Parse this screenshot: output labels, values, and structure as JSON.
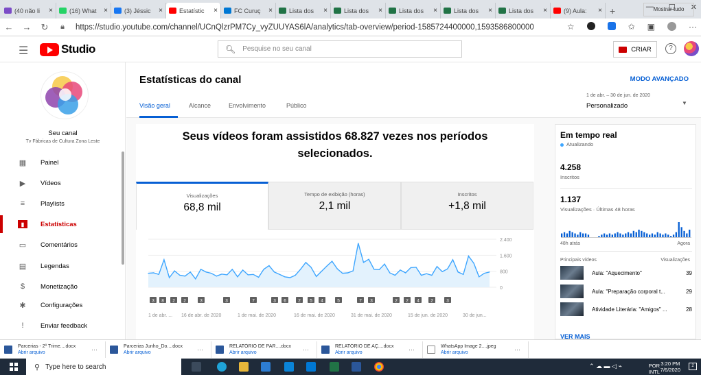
{
  "browser": {
    "tabs": [
      {
        "label": "(40 não li",
        "color": "#7b4cc7",
        "active": false
      },
      {
        "label": "(16) What",
        "color": "#25d366",
        "active": false
      },
      {
        "label": "(3) Jéssic",
        "color": "#1877f2",
        "active": false
      },
      {
        "label": "Estatístic",
        "color": "#ff0000",
        "active": true
      },
      {
        "label": "FC Curuç",
        "color": "#0078d4",
        "active": false
      },
      {
        "label": "Lista dos",
        "color": "#217346",
        "active": false
      },
      {
        "label": "Lista dos",
        "color": "#217346",
        "active": false
      },
      {
        "label": "Lista dos",
        "color": "#217346",
        "active": false
      },
      {
        "label": "Lista dos",
        "color": "#217346",
        "active": false
      },
      {
        "label": "Lista dos",
        "color": "#217346",
        "active": false
      },
      {
        "label": "(9) Aula:",
        "color": "#ff0000",
        "active": false
      }
    ],
    "url": "https://studio.youtube.com/channel/UCnQlzrPM7Cy_vyZUUYAS6lA/analytics/tab-overview/period-1585724400000,1593586800000"
  },
  "header": {
    "logo_text": "Studio",
    "search_placeholder": "Pesquise no seu canal",
    "criar_label": "CRIAR",
    "help_icon": "?"
  },
  "sidebar": {
    "channel_name": "Seu canal",
    "channel_sub": "Tv Fábricas de Cultura Zona Leste",
    "items": [
      {
        "label": "Painel",
        "icon": "dashboard-icon",
        "glyph": "▦",
        "active": false
      },
      {
        "label": "Vídeos",
        "icon": "videos-icon",
        "glyph": "▶",
        "active": false
      },
      {
        "label": "Playlists",
        "icon": "playlists-icon",
        "glyph": "≡",
        "active": false
      },
      {
        "label": "Estatísticas",
        "icon": "analytics-icon",
        "glyph": "▮",
        "active": true
      },
      {
        "label": "Comentários",
        "icon": "comments-icon",
        "glyph": "▭",
        "active": false
      },
      {
        "label": "Legendas",
        "icon": "subtitles-icon",
        "glyph": "▤",
        "active": false
      },
      {
        "label": "Monetização",
        "icon": "monetization-icon",
        "glyph": "$",
        "active": false
      },
      {
        "label": "Configurações",
        "icon": "settings-icon",
        "glyph": "✱",
        "active": false
      },
      {
        "label": "Enviar feedback",
        "icon": "feedback-icon",
        "glyph": "!",
        "active": false
      }
    ]
  },
  "page": {
    "title": "Estatísticas do canal",
    "advanced": "MODO AVANÇADO",
    "tabs": [
      "Visão geral",
      "Alcance",
      "Envolvimento",
      "Público"
    ],
    "date_range": "1 de abr. – 30 de jun. de 2020",
    "date_preset": "Personalizado",
    "headline": "Seus vídeos foram assistidos 68.827 vezes nos períodos selecionados.",
    "metrics": [
      {
        "label": "Visualizações",
        "value": "68,8 mil"
      },
      {
        "label": "Tempo de exibição (horas)",
        "value": "2,1 mil"
      },
      {
        "label": "Inscritos",
        "value": "+1,8 mil"
      }
    ]
  },
  "chart_data": {
    "type": "line",
    "x": [
      "1 de abr. ...",
      "16 de abr. de 2020",
      "1 de mai. de 2020",
      "16 de mai. de 2020",
      "31 de mai. de 2020",
      "15 de jun. de 2020",
      "30 de jun..."
    ],
    "ylim": [
      0,
      2400
    ],
    "yticks": [
      "2.400",
      "1.600",
      "800",
      "0"
    ],
    "values": [
      700,
      720,
      640,
      1380,
      480,
      820,
      600,
      560,
      760,
      420,
      900,
      760,
      700,
      560,
      660,
      620,
      900,
      520,
      860,
      620,
      640,
      500,
      900,
      1080,
      760,
      640,
      520,
      480,
      600,
      900,
      1240,
      1000,
      540,
      800,
      1060,
      1300,
      920,
      700,
      720,
      820,
      2200,
      1240,
      1400,
      900,
      880,
      1160,
      720,
      600,
      860,
      720,
      980,
      1000,
      600,
      680,
      600,
      1040,
      780,
      920,
      1380,
      760,
      640,
      1560,
      1200,
      520,
      700,
      760
    ],
    "markers": [
      "3",
      "8",
      "2",
      "2",
      "3",
      "3",
      "7",
      "3",
      "6",
      "2",
      "5",
      "4",
      "5",
      "7",
      "3",
      "2",
      "2",
      "4",
      "2",
      "3"
    ],
    "color": "#3ea6ff"
  },
  "realtime": {
    "title": "Em tempo real",
    "updating": "Atualizando",
    "subs_value": "4.258",
    "subs_label": "Inscritos",
    "views_value": "1.137",
    "views_label": "Visualizações · Últimas 48 horas",
    "label_48h": "48h atrás",
    "label_now": "Agora",
    "bars": [
      3,
      4,
      3,
      5,
      4,
      3,
      2,
      4,
      3,
      3,
      2,
      0,
      0,
      0,
      1,
      2,
      3,
      2,
      3,
      2,
      3,
      4,
      3,
      2,
      3,
      4,
      3,
      5,
      4,
      6,
      5,
      4,
      3,
      2,
      3,
      2,
      4,
      3,
      2,
      3,
      2,
      1,
      2,
      4,
      12,
      8,
      5,
      3,
      6
    ],
    "top_videos_label": "Principais vídeos",
    "views_col_label": "Visualizações",
    "videos": [
      {
        "title": "Aula: \"Aquecimento\"",
        "views": "39"
      },
      {
        "title": "Aula: \"Preparação corporal t...",
        "views": "29"
      },
      {
        "title": "Atividade Literária: \"Amigos\" ...",
        "views": "28"
      }
    ],
    "see_more": "VER MAIS"
  },
  "downloads": {
    "items": [
      {
        "name": "Parcerias - 2º Trime....docx",
        "action": "Abrir arquivo"
      },
      {
        "name": "Parcerias Junho_Do....docx",
        "action": "Abrir arquivo"
      },
      {
        "name": "RELATÓRIO DE PAR....docx",
        "action": "Abrir arquivo"
      },
      {
        "name": "RELATÓRIO DE AÇ....docx",
        "action": "Abrir arquivo"
      },
      {
        "name": "WhatsApp Image 2....jpeg",
        "action": "Abrir arquivo"
      }
    ],
    "show_all": "Mostrar tudo"
  },
  "taskbar": {
    "search_placeholder": "Type here to search",
    "lang": "POR",
    "lang2": "INTL",
    "time": "3:20 PM",
    "date": "7/6/2020"
  }
}
